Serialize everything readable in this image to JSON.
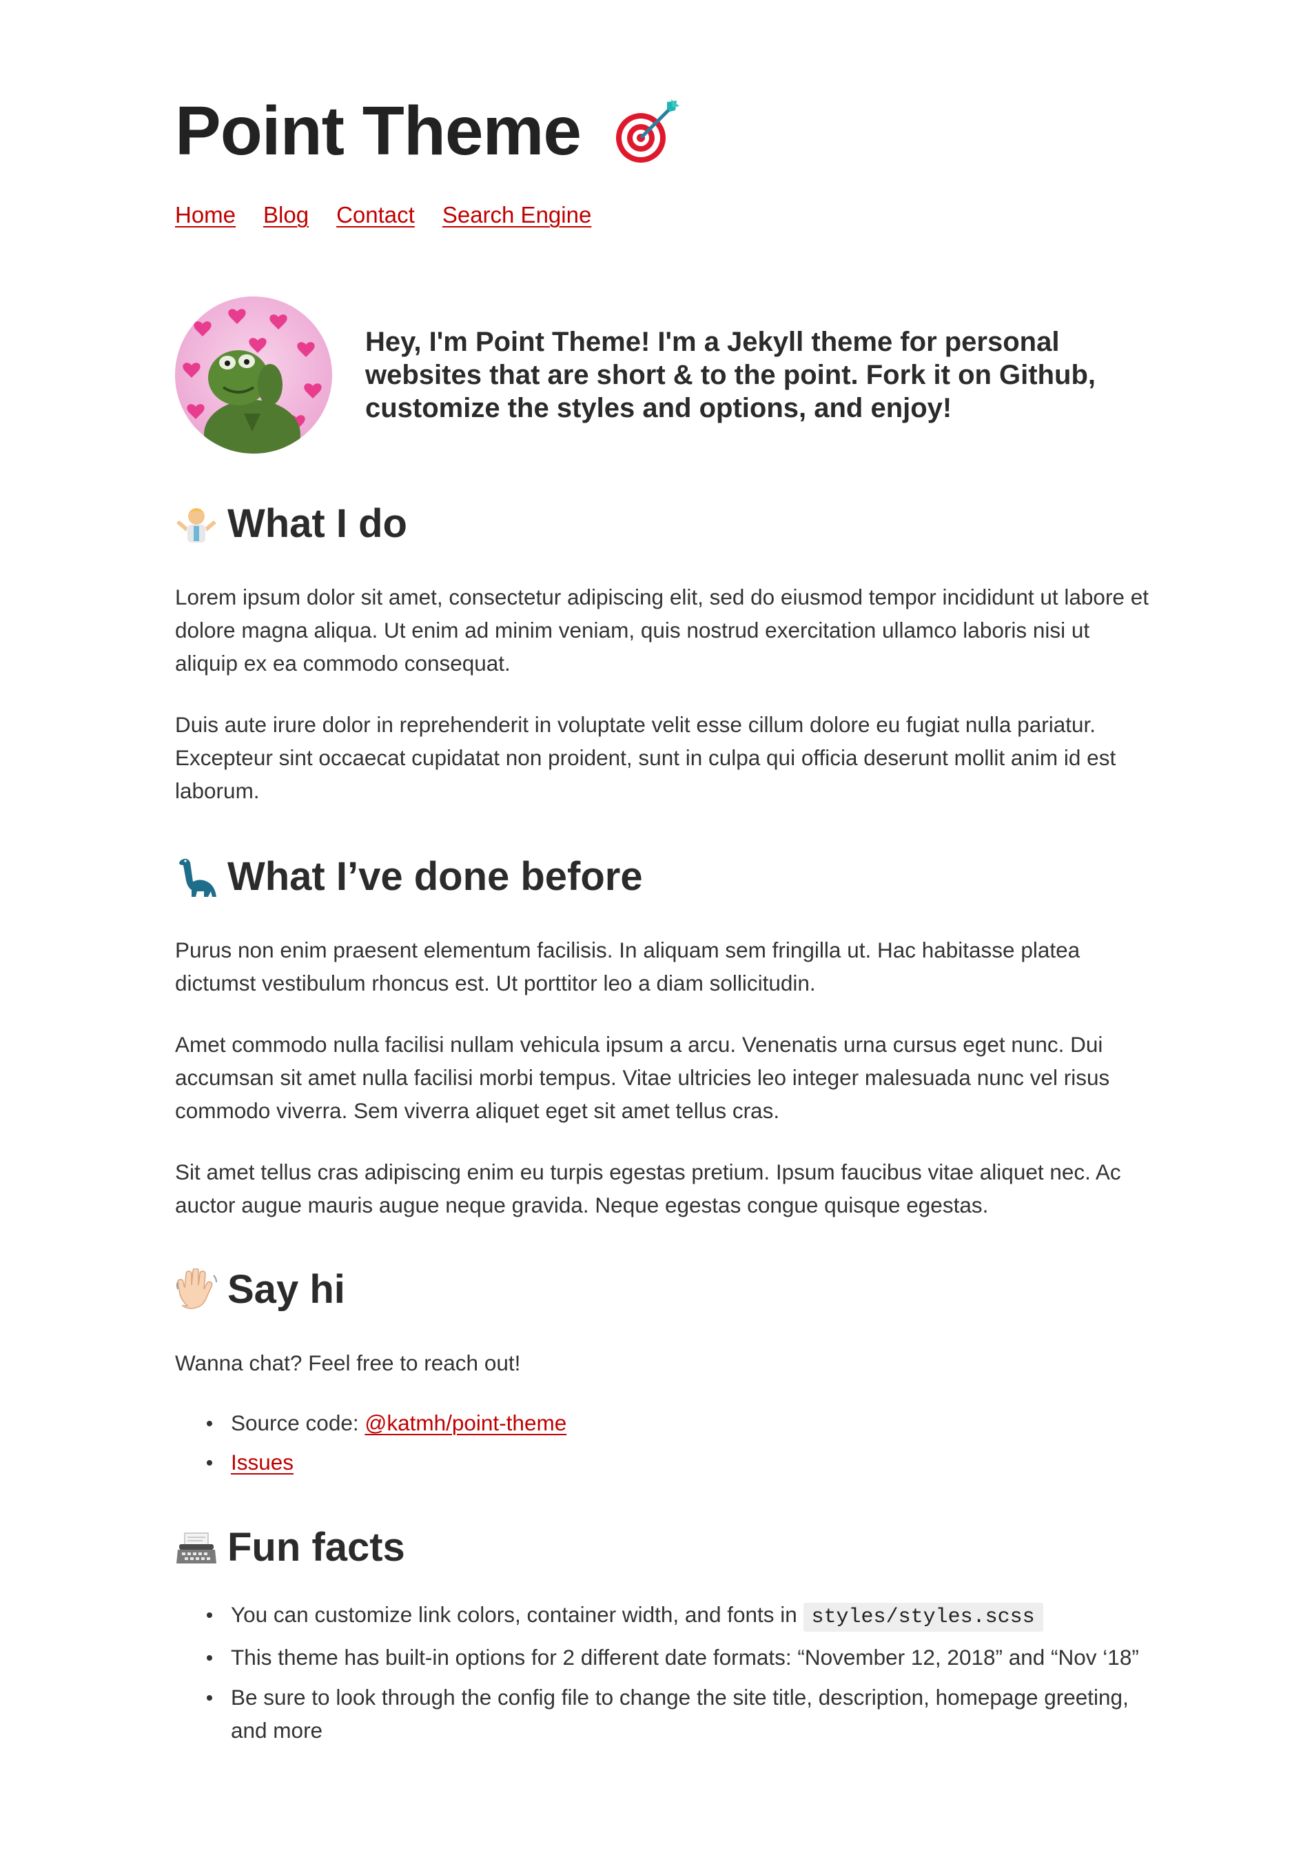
{
  "header": {
    "site_title": "Point Theme",
    "title_icon": "dart-target-icon"
  },
  "nav": {
    "items": [
      {
        "label": "Home"
      },
      {
        "label": "Blog"
      },
      {
        "label": "Contact"
      },
      {
        "label": "Search Engine"
      }
    ]
  },
  "intro": {
    "avatar_icon": "kermit-avatar",
    "text": "Hey, I'm Point Theme! I'm a Jekyll theme for personal websites that are short & to the point. Fork it on Github, customize the styles and options, and enjoy!"
  },
  "sections": [
    {
      "icon": "shrugging-man-icon",
      "heading": "What I do",
      "paragraphs": [
        "Lorem ipsum dolor sit amet, consectetur adipiscing elit, sed do eiusmod tempor incididunt ut labore et dolore magna aliqua. Ut enim ad minim veniam, quis nostrud exercitation ullamco laboris nisi ut aliquip ex ea commodo consequat.",
        "Duis aute irure dolor in reprehenderit in voluptate velit esse cillum dolore eu fugiat nulla pariatur. Excepteur sint occaecat cupidatat non proident, sunt in culpa qui officia deserunt mollit anim id est laborum."
      ]
    },
    {
      "icon": "dinosaur-icon",
      "heading": "What I’ve done before",
      "paragraphs": [
        "Purus non enim praesent elementum facilisis. In aliquam sem fringilla ut. Hac habitasse platea dictumst vestibulum rhoncus est. Ut porttitor leo a diam sollicitudin.",
        "Amet commodo nulla facilisi nullam vehicula ipsum a arcu. Venenatis urna cursus eget nunc. Dui accumsan sit amet nulla facilisi morbi tempus. Vitae ultricies leo integer malesuada nunc vel risus commodo viverra. Sem viverra aliquet eget sit amet tellus cras.",
        "Sit amet tellus cras adipiscing enim eu turpis egestas pretium. Ipsum faucibus vitae aliquet nec. Ac auctor augue mauris augue neque gravida. Neque egestas congue quisque egestas."
      ]
    },
    {
      "icon": "waving-hand-icon",
      "heading": "Say hi",
      "paragraphs": [
        "Wanna chat? Feel free to reach out!"
      ],
      "list": [
        {
          "prefix": "Source code: ",
          "link": "@katmh/point-theme"
        },
        {
          "prefix": "",
          "link": "Issues"
        }
      ]
    },
    {
      "icon": "typewriter-icon",
      "heading": "Fun facts",
      "list": [
        {
          "text": "You can customize link colors, container width, and fonts in ",
          "code": "styles/styles.scss"
        },
        {
          "text": "This theme has built-in options for 2 different date formats: “November 12, 2018” and “Nov ‘18”"
        },
        {
          "text": "Be sure to look through the config file to change the site title, description, homepage greeting, and more"
        }
      ]
    }
  ],
  "colors": {
    "link": "#c00000",
    "text": "#333333",
    "heading": "#2b2b2b",
    "code_bg": "#eeeeee"
  }
}
